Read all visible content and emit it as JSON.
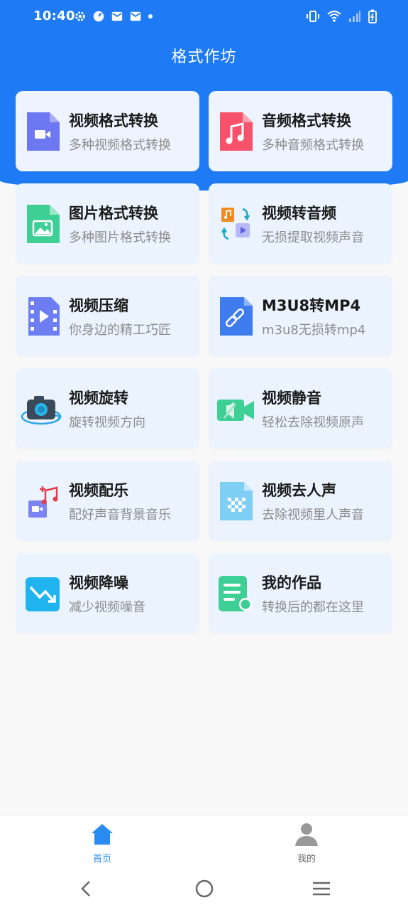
{
  "status_bar": {
    "time": "10:40"
  },
  "header": {
    "title": "格式作坊"
  },
  "cards": [
    {
      "title": "视频格式转换",
      "subtitle": "多种视频格式转换",
      "icon": "video-file-icon"
    },
    {
      "title": "音频格式转换",
      "subtitle": "多种音频格式转换",
      "icon": "audio-file-icon"
    },
    {
      "title": "图片格式转换",
      "subtitle": "多种图片格式转换",
      "icon": "image-file-icon"
    },
    {
      "title": "视频转音频",
      "subtitle": "无损提取视频声音",
      "icon": "video-to-audio-icon"
    },
    {
      "title": "视频压缩",
      "subtitle": "你身边的精工巧匠",
      "icon": "film-strip-icon"
    },
    {
      "title": "M3U8转MP4",
      "subtitle": "m3u8无损转mp4",
      "icon": "link-file-icon"
    },
    {
      "title": "视频旋转",
      "subtitle": "旋转视频方向",
      "icon": "camera-rotate-icon"
    },
    {
      "title": "视频静音",
      "subtitle": "轻松去除视频原声",
      "icon": "video-mute-icon"
    },
    {
      "title": "视频配乐",
      "subtitle": "配好声音背景音乐",
      "icon": "add-music-icon"
    },
    {
      "title": "视频去人声",
      "subtitle": "去除视频里人声音",
      "icon": "checker-file-icon"
    },
    {
      "title": "视频降噪",
      "subtitle": "减少视频噪音",
      "icon": "trend-down-icon"
    },
    {
      "title": "我的作品",
      "subtitle": "转换后的都在这里",
      "icon": "document-list-icon"
    }
  ],
  "tabs": [
    {
      "label": "首页",
      "icon": "home-icon",
      "active": true
    },
    {
      "label": "我的",
      "icon": "user-icon",
      "active": false
    }
  ],
  "colors": {
    "primary": "#1f7bf5",
    "card_bg": "#ebf3ff",
    "tab_active": "#2a8cf0",
    "tab_inactive": "#888888"
  }
}
